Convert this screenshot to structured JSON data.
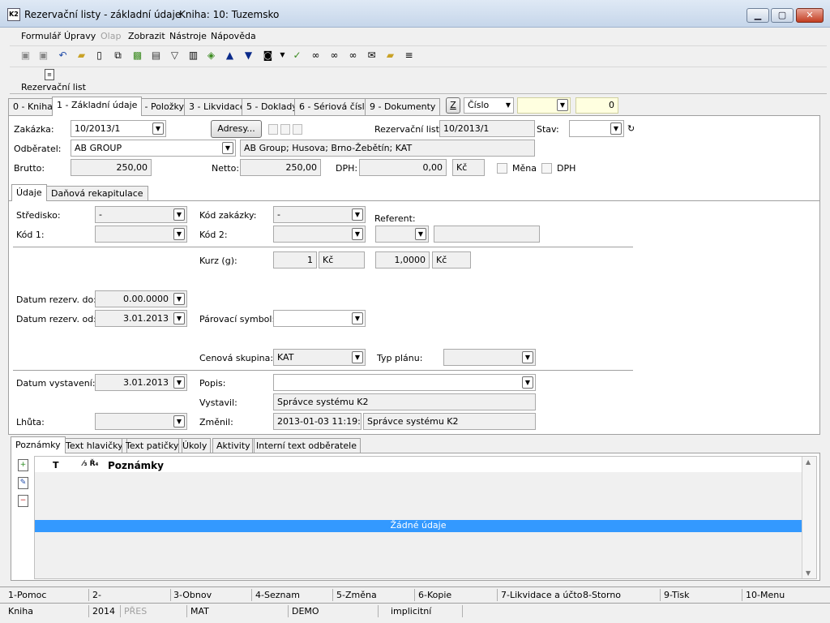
{
  "window": {
    "title": "Rezervační listy - základní údaje",
    "subtitle": "Kniha: 10: Tuzemsko"
  },
  "menu": [
    "Formulář",
    "Úpravy",
    "Olap",
    "Zobrazit",
    "Nástroje",
    "Nápověda"
  ],
  "ribbon": {
    "label": "Rezervační list"
  },
  "tabs": [
    "0 - Kniha",
    "1 - Základní údaje",
    "2 - Položky",
    "3 - Likvidace",
    "5 - Doklady",
    "6 - Sériová čísla",
    "9 - Dokumenty"
  ],
  "search": {
    "z_label": "Z",
    "field": "Číslo",
    "value": "0"
  },
  "header": {
    "zakazka_label": "Zakázka:",
    "zakazka": "10/2013/1",
    "adresy_label": "Adresy...",
    "rezlist_label": "Rezervační list:",
    "rezlist": "10/2013/1",
    "stav_label": "Stav:",
    "odberatel_label": "Odběratel:",
    "odberatel": "AB GROUP",
    "adresa": "AB Group; Husova; Brno-Žebětín; KAT",
    "brutto_label": "Brutto:",
    "brutto": "250,00",
    "netto_label": "Netto:",
    "netto": "250,00",
    "dph_label": "DPH:",
    "dph": "0,00",
    "mena_code": "Kč",
    "mena_chk": "Měna",
    "dph_chk": "DPH"
  },
  "subtabs": [
    "Údaje",
    "Daňová rekapitulace"
  ],
  "detail": {
    "stredisko_label": "Středisko:",
    "stredisko": "-",
    "kod_zakazky_label": "Kód zakázky:",
    "kod_zakazky": "-",
    "referent_label": "Referent:",
    "kod1_label": "Kód 1:",
    "kod2_label": "Kód 2:",
    "kurz_label": "Kurz (g):",
    "kurz1": "1",
    "kurz1_cur": "Kč",
    "kurz2": "1,0000",
    "kurz2_cur": "Kč",
    "datum_do_label": "Datum rezerv. do:",
    "datum_do": "0.00.0000",
    "datum_od_label": "Datum rezerv. od:",
    "datum_od": "3.01.2013",
    "parovaci_label": "Párovací symbol:",
    "cenova_label": "Cenová skupina:",
    "cenova": "KAT",
    "typ_planu_label": "Typ plánu:",
    "vystaveni_label": "Datum vystavení:",
    "vystaveni": "3.01.2013",
    "popis_label": "Popis:",
    "vystavil_label": "Vystavil:",
    "vystavil": "Správce systému K2",
    "lhuta_label": "Lhůta:",
    "zmenil_label": "Změnil:",
    "zmenil_date": "2013-01-03 11:19:55",
    "zmenil_user": "Správce systému K2"
  },
  "bottomtabs": [
    "Poznámky",
    "Text hlavičky",
    "Text patičky",
    "Úkoly",
    "Aktivity",
    "Interní text odběratele"
  ],
  "notes": {
    "col_t": "T",
    "col_mid": "⁄₃ Ř₄",
    "col_name": "Poznámky",
    "empty": "Žádné údaje"
  },
  "fkeys": [
    "1-Pomoc",
    "2-",
    "3-Obnov",
    "4-Seznam",
    "5-Změna",
    "6-Kopie",
    "7-Likvidace a účtová",
    "8-Storno",
    "9-Tisk",
    "10-Menu"
  ],
  "statusbar": [
    "Kniha",
    "2014",
    "PŘES",
    "MAT",
    "DEMO",
    "implicitní"
  ],
  "colors": {
    "highlight": "#3399ff",
    "titlebar": "#c6d6ea",
    "search_bg": "#ffffe0"
  }
}
